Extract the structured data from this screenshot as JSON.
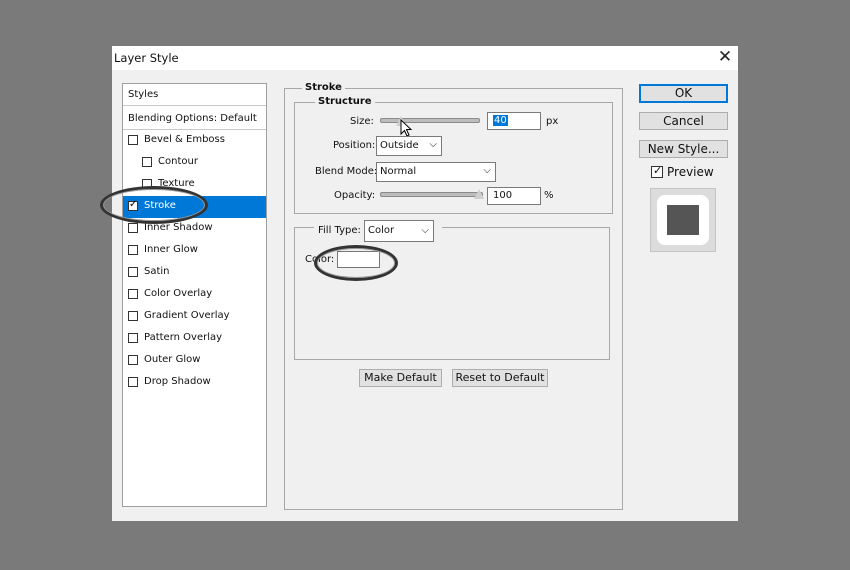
{
  "dialog": {
    "title": "Layer Style"
  },
  "styles_panel": {
    "header": "Styles",
    "blending_options": "Blending Options: Default",
    "items": [
      {
        "label": "Bevel & Emboss",
        "checked": false
      },
      {
        "label": "Contour",
        "checked": false
      },
      {
        "label": "Texture",
        "checked": false
      },
      {
        "label": "Stroke",
        "checked": true
      },
      {
        "label": "Inner Shadow",
        "checked": false
      },
      {
        "label": "Inner Glow",
        "checked": false
      },
      {
        "label": "Satin",
        "checked": false
      },
      {
        "label": "Color Overlay",
        "checked": false
      },
      {
        "label": "Gradient Overlay",
        "checked": false
      },
      {
        "label": "Pattern Overlay",
        "checked": false
      },
      {
        "label": "Outer Glow",
        "checked": false
      },
      {
        "label": "Drop Shadow",
        "checked": false
      }
    ]
  },
  "stroke": {
    "section_label": "Stroke",
    "structure_label": "Structure",
    "size_label": "Size:",
    "size_value": "40",
    "size_unit": "px",
    "position_label": "Position:",
    "position_value": "Outside",
    "blend_mode_label": "Blend Mode:",
    "blend_mode_value": "Normal",
    "opacity_label": "Opacity:",
    "opacity_value": "100",
    "opacity_unit": "%",
    "fill_type_label": "Fill Type:",
    "fill_type_value": "Color",
    "color_label": "Color:",
    "color_swatch": "#ffffff",
    "make_default_label": "Make Default",
    "reset_default_label": "Reset to Default"
  },
  "buttons": {
    "ok": "OK",
    "cancel": "Cancel",
    "new_style": "New Style...",
    "preview_label": "Preview",
    "preview_checked": true
  },
  "colors": {
    "selection": "#0078d7",
    "preview_fill": "#555555"
  }
}
